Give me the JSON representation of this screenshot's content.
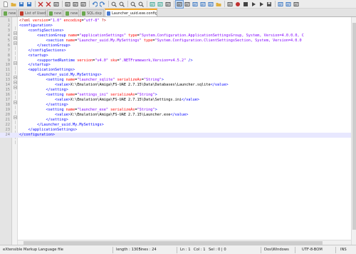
{
  "toolbar": {
    "icons": [
      "new-file-icon",
      "open-icon",
      "save-icon",
      "save-all-icon",
      "close-icon",
      "close-all-icon",
      "print-icon",
      "cut-icon",
      "copy-icon",
      "paste-icon",
      "undo-icon",
      "redo-icon",
      "find-icon",
      "replace-icon",
      "zoom-in-icon",
      "zoom-out-icon",
      "sync-v-icon",
      "sync-h-icon",
      "word-wrap-icon",
      "show-all-chars-icon",
      "indent-guide-icon",
      "user-lang-icon",
      "doc-map-icon",
      "function-list-icon",
      "folder-workspace-icon",
      "monitoring-icon",
      "record-macro-icon",
      "stop-macro-icon",
      "play-macro-icon",
      "run-macro-icon",
      "save-macro-icon",
      "spell-check-icon",
      "spell-next-icon",
      "hex-editor-icon"
    ]
  },
  "tabs": [
    {
      "label": "new 2"
    },
    {
      "label": "List of Used dir..."
    },
    {
      "label": "new 3"
    },
    {
      "label": "new 5"
    },
    {
      "label": "SQL.dxp"
    },
    {
      "label": "Launcher_uuid.exe.config",
      "active": true
    }
  ],
  "editor": {
    "lines": [
      [
        [
          "pi",
          "<?xml "
        ],
        [
          "a",
          "version"
        ],
        [
          "p",
          "="
        ],
        [
          "v",
          "\"1.0\""
        ],
        [
          "p",
          " "
        ],
        [
          "a",
          "encoding"
        ],
        [
          "p",
          "="
        ],
        [
          "v",
          "\"utf-8\""
        ],
        [
          "pi",
          " ?>"
        ]
      ],
      [
        [
          "t",
          "<configuration>"
        ]
      ],
      [
        [
          "p",
          "    "
        ],
        [
          "t",
          "<configSections>"
        ]
      ],
      [
        [
          "p",
          "        "
        ],
        [
          "t",
          "<sectionGroup "
        ],
        [
          "a",
          "name"
        ],
        [
          "p",
          "="
        ],
        [
          "v",
          "\"applicationSettings\""
        ],
        [
          "p",
          " "
        ],
        [
          "a",
          "type"
        ],
        [
          "p",
          "="
        ],
        [
          "v",
          "\"System.Configuration.ApplicationSettingsGroup, System, Version=4.0.0.0, C"
        ]
      ],
      [
        [
          "p",
          "            "
        ],
        [
          "t",
          "<section "
        ],
        [
          "a",
          "name"
        ],
        [
          "p",
          "="
        ],
        [
          "v",
          "\"Launcher_uuid.My.MySettings\""
        ],
        [
          "p",
          " "
        ],
        [
          "a",
          "type"
        ],
        [
          "p",
          "="
        ],
        [
          "v",
          "\"System.Configuration.ClientSettingsSection, System, Version=4.0.0"
        ]
      ],
      [
        [
          "p",
          "        "
        ],
        [
          "t",
          "</sectionGroup>"
        ]
      ],
      [
        [
          "p",
          "    "
        ],
        [
          "t",
          "</configSections>"
        ]
      ],
      [
        [
          "p",
          "    "
        ],
        [
          "t",
          "<startup>"
        ]
      ],
      [
        [
          "p",
          "        "
        ],
        [
          "t",
          "<supportedRuntime "
        ],
        [
          "a",
          "version"
        ],
        [
          "p",
          "="
        ],
        [
          "v",
          "\"v4.0\""
        ],
        [
          "p",
          " "
        ],
        [
          "a",
          "sku"
        ],
        [
          "p",
          "="
        ],
        [
          "v",
          "\".NETFramework,Version=v4.5.2\""
        ],
        [
          "t",
          " />"
        ]
      ],
      [
        [
          "p",
          "    "
        ],
        [
          "t",
          "</startup>"
        ]
      ],
      [
        [
          "p",
          "    "
        ],
        [
          "t",
          "<applicationSettings>"
        ]
      ],
      [
        [
          "p",
          "        "
        ],
        [
          "t",
          "<Launcher_uuid.My.MySettings>"
        ]
      ],
      [
        [
          "p",
          "            "
        ],
        [
          "t",
          "<setting "
        ],
        [
          "a",
          "name"
        ],
        [
          "p",
          "="
        ],
        [
          "v",
          "\"launcher_sqlite\""
        ],
        [
          "p",
          " "
        ],
        [
          "a",
          "serializeAs"
        ],
        [
          "p",
          "="
        ],
        [
          "v",
          "\"String\""
        ],
        [
          "t",
          ">"
        ]
      ],
      [
        [
          "p",
          "                "
        ],
        [
          "t",
          "<value>"
        ],
        [
          "p",
          "X:\\Emulation\\Amiga\\FS-UAE 2.7.15\\Data\\Databases\\Launcher.sqlite"
        ],
        [
          "t",
          "</value>"
        ]
      ],
      [
        [
          "p",
          "            "
        ],
        [
          "t",
          "</setting>"
        ]
      ],
      [
        [
          "p",
          "            "
        ],
        [
          "t",
          "<setting "
        ],
        [
          "a",
          "name"
        ],
        [
          "p",
          "="
        ],
        [
          "v",
          "\"settings_ini\""
        ],
        [
          "p",
          " "
        ],
        [
          "a",
          "serializeAs"
        ],
        [
          "p",
          "="
        ],
        [
          "v",
          "\"String\""
        ],
        [
          "t",
          ">"
        ]
      ],
      [
        [
          "p",
          "                "
        ],
        [
          "t",
          "<value>"
        ],
        [
          "p",
          "X:\\Emulation\\Amiga\\FS-UAE 2.7.15\\Data\\Settings.ini"
        ],
        [
          "t",
          "</value>"
        ]
      ],
      [
        [
          "p",
          "            "
        ],
        [
          "t",
          "</setting>"
        ]
      ],
      [
        [
          "p",
          "            "
        ],
        [
          "t",
          "<setting "
        ],
        [
          "a",
          "name"
        ],
        [
          "p",
          "="
        ],
        [
          "v",
          "\"launcher_exe\""
        ],
        [
          "p",
          " "
        ],
        [
          "a",
          "serializeAs"
        ],
        [
          "p",
          "="
        ],
        [
          "v",
          "\"String\""
        ],
        [
          "t",
          ">"
        ]
      ],
      [
        [
          "p",
          "                "
        ],
        [
          "t",
          "<value>"
        ],
        [
          "p",
          "X:\\Emulation\\Amiga\\FS-UAE 2.7.15\\Launcher.exe"
        ],
        [
          "t",
          "</value>"
        ]
      ],
      [
        [
          "p",
          "            "
        ],
        [
          "t",
          "</setting>"
        ]
      ],
      [
        [
          "p",
          "        "
        ],
        [
          "t",
          "</Launcher_uuid.My.MySettings>"
        ]
      ],
      [
        [
          "p",
          "    "
        ],
        [
          "t",
          "</applicationSettings>"
        ]
      ],
      [
        [
          "t",
          "</configuration>"
        ]
      ]
    ],
    "fold_lines": [
      2,
      3,
      4,
      8,
      11,
      12,
      13,
      16,
      19
    ],
    "current_line": 24
  },
  "status": {
    "file_type": "eXtensible Markup Language file",
    "length": "length : 1305",
    "lines": "lines : 24",
    "ln": "Ln : 1",
    "col": "Col : 1",
    "sel": "Sel : 0 | 0",
    "eol": "Dos\\Windows",
    "encoding": "UTF-8-BOM",
    "mode": "INS"
  }
}
